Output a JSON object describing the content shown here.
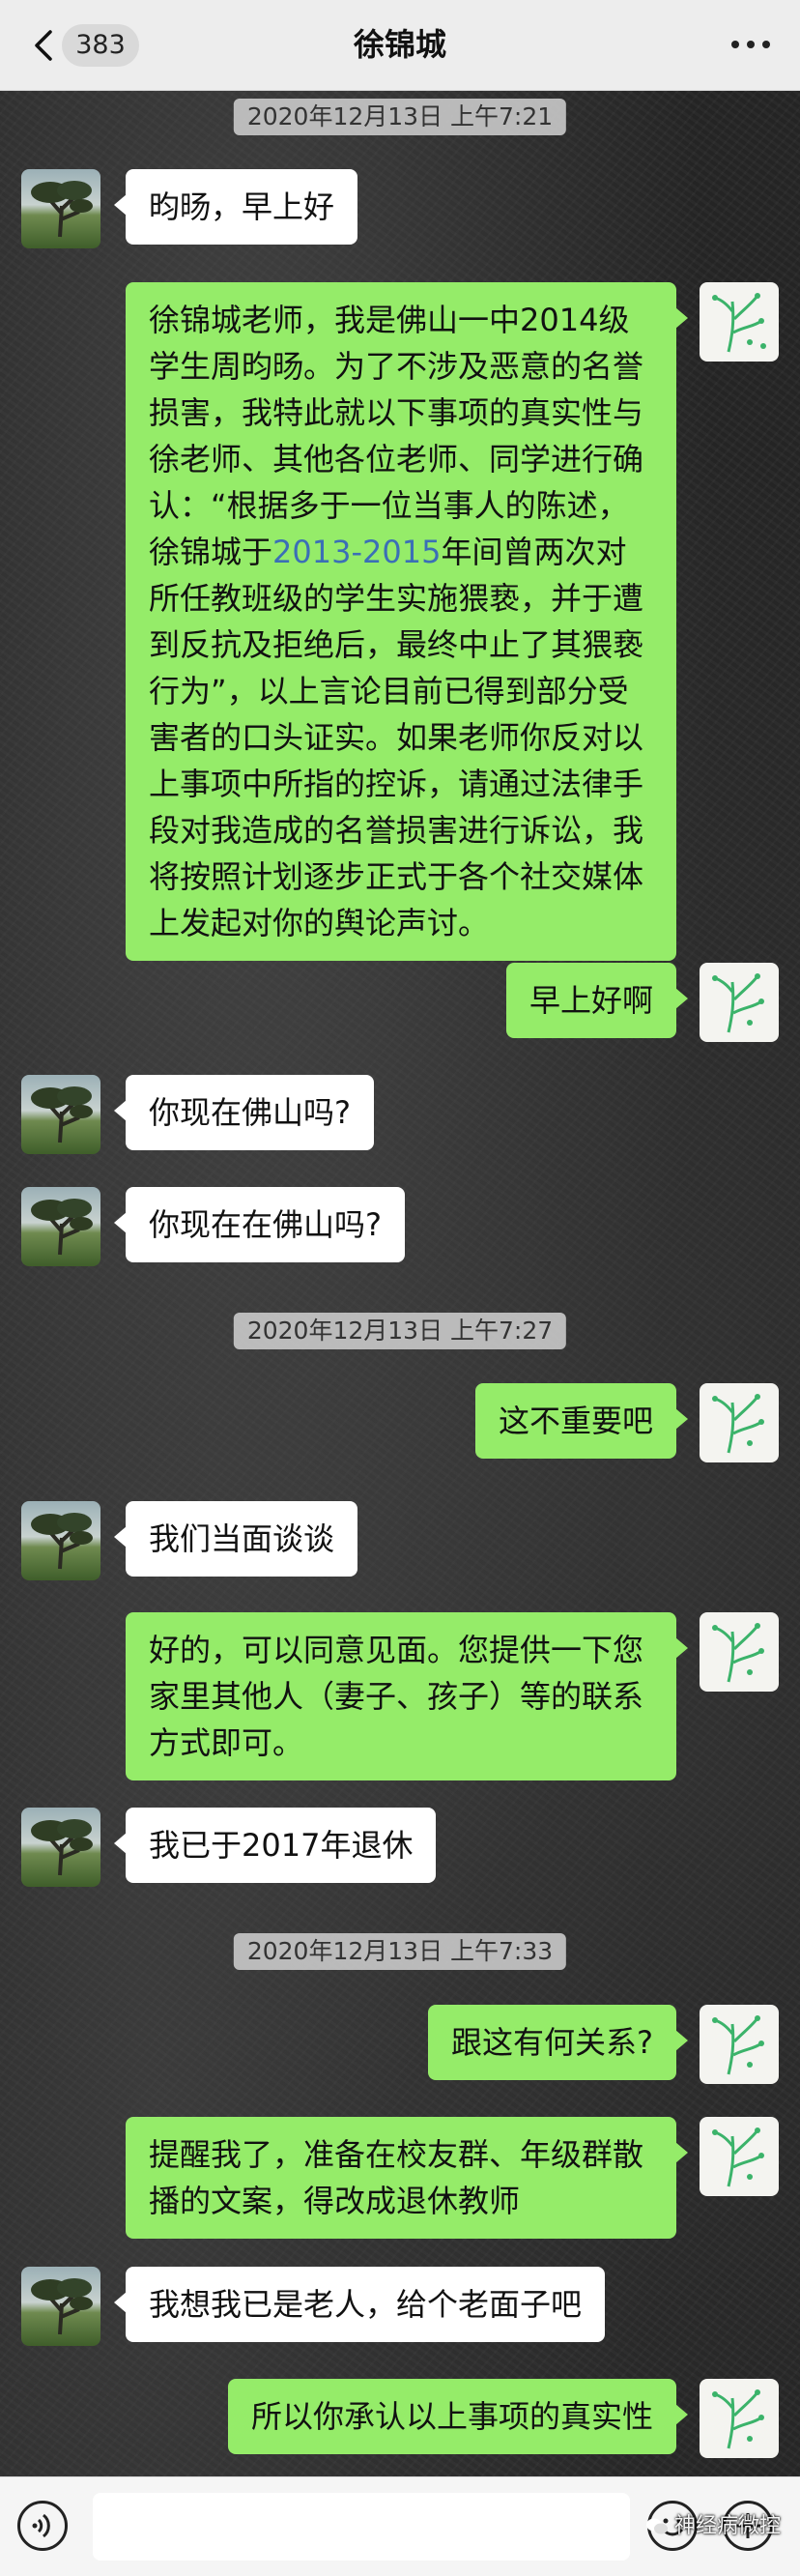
{
  "header": {
    "unread_count": "383",
    "title": "徐锦城"
  },
  "timestamps": [
    "2020年12月13日 上午7:21",
    "2020年12月13日 上午7:27",
    "2020年12月13日 上午7:33"
  ],
  "messages": [
    {
      "side": "left",
      "text": "昀旸，早上好"
    },
    {
      "side": "right",
      "text_before": "徐锦城老师，我是佛山一中2014级学生周昀旸。为了不涉及恶意的名誉损害，我特此就以下事项的真实性与徐老师、其他各位老师、同学进行确认：“根据多于一位当事人的陈述，徐锦城于",
      "link": "2013-2015",
      "text_after": "年间曾两次对所任教班级的学生实施猥亵，并于遭到反抗及拒绝后，最终中止了其猥亵行为”，以上言论目前已得到部分受害者的口头证实。如果老师你反对以上事项中所指的控诉，请通过法律手段对我造成的名誉损害进行诉讼，我将按照计划逐步正式于各个社交媒体上发起对你的舆论声讨。"
    },
    {
      "side": "right",
      "text": "早上好啊"
    },
    {
      "side": "left",
      "text": "你现在佛山吗?"
    },
    {
      "side": "left",
      "text": "你现在在佛山吗?"
    },
    {
      "side": "right",
      "text": "这不重要吧"
    },
    {
      "side": "left",
      "text": "我们当面谈谈"
    },
    {
      "side": "right",
      "text": "好的，可以同意见面。您提供一下您家里其他人（妻子、孩子）等的联系方式即可。"
    },
    {
      "side": "left",
      "text": "我已于2017年退休"
    },
    {
      "side": "right",
      "text": "跟这有何关系?"
    },
    {
      "side": "right",
      "text": "提醒我了，准备在校友群、年级群散播的文案，得改成退休教师"
    },
    {
      "side": "left",
      "text": "我想我已是老人，给个老面子吧"
    },
    {
      "side": "right",
      "text": "所以你承认以上事项的真实性"
    }
  ],
  "input": {
    "value": ""
  },
  "watermark": "神经病微控",
  "colors": {
    "self_bubble": "#95ec69",
    "other_bubble": "#ffffff",
    "header_bg": "#ededed"
  },
  "icons": [
    "back-chevron-icon",
    "more-dots-icon",
    "tree-avatar-icon",
    "plant-avatar-icon",
    "voice-icon",
    "emoji-icon",
    "plus-icon"
  ]
}
